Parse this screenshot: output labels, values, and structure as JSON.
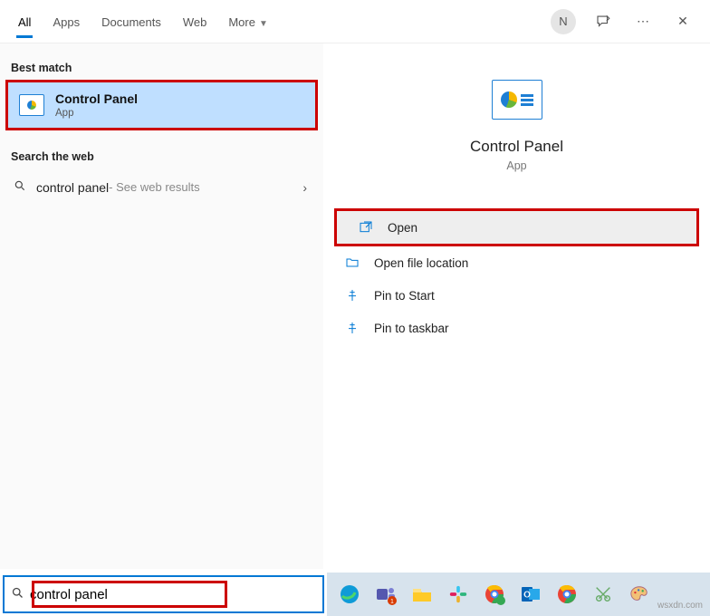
{
  "tabs": {
    "all": "All",
    "apps": "Apps",
    "documents": "Documents",
    "web": "Web",
    "more": "More"
  },
  "header": {
    "avatar_initial": "N"
  },
  "left": {
    "best_match_label": "Best match",
    "result": {
      "title": "Control Panel",
      "subtitle": "App"
    },
    "search_web_label": "Search the web",
    "web": {
      "query": "control panel",
      "hint": " - See web results"
    }
  },
  "preview": {
    "title": "Control Panel",
    "subtitle": "App"
  },
  "actions": {
    "open": "Open",
    "open_location": "Open file location",
    "pin_start": "Pin to Start",
    "pin_taskbar": "Pin to taskbar"
  },
  "search": {
    "value": "control panel"
  },
  "watermark": "wsxdn.com"
}
